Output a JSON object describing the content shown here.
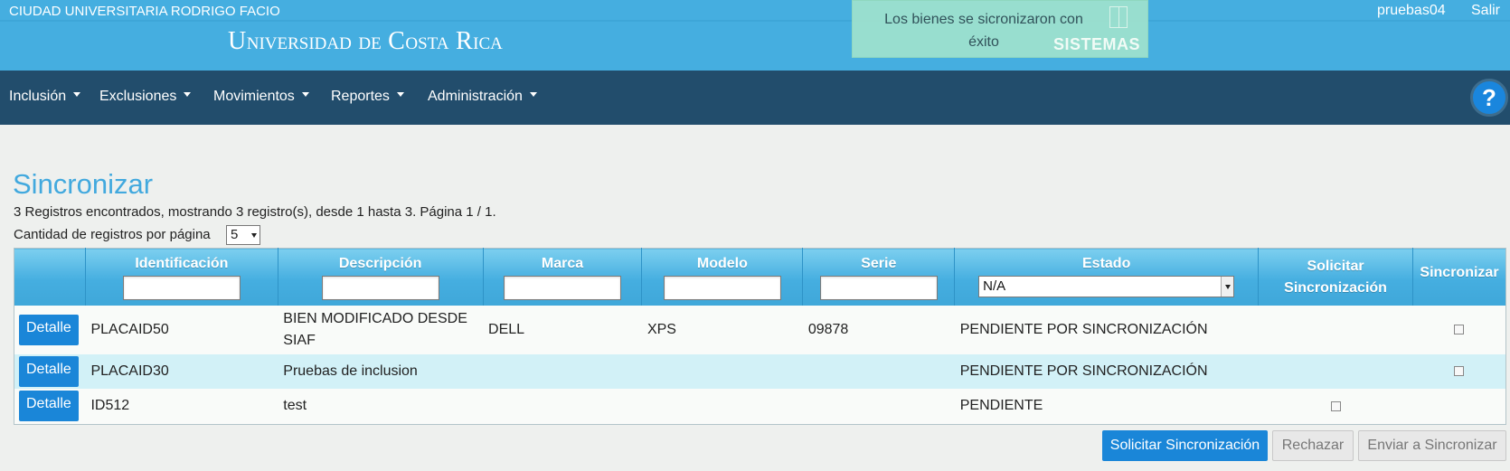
{
  "header": {
    "campus": "CIUDAD UNIVERSITARIA RODRIGO FACIO",
    "logo_big_u": "U",
    "logo_niversidad": "NIVERSIDAD",
    "logo_de": "DE",
    "logo_c": "C",
    "logo_osta": "OSTA",
    "logo_r": "R",
    "logo_ica": "ICA",
    "user": "pruebas04",
    "logout": "Salir"
  },
  "toast": {
    "message_line1": "Los bienes se sicronizaron con",
    "message_line2": "éxito",
    "system_label": "SISTEMAS"
  },
  "nav": {
    "items": [
      "Inclusión",
      "Exclusiones",
      "Movimientos",
      "Reportes",
      "Administración"
    ],
    "help_icon": "question-mark-icon",
    "help_label": "?"
  },
  "page": {
    "title": "Sincronizar",
    "records_summary": "3 Registros encontrados, mostrando 3 registro(s), desde 1 hasta 3. Página 1 / 1.",
    "per_page_label": "Cantidad de registros por página",
    "per_page_value": "5"
  },
  "table": {
    "headers": {
      "identificacion": "Identificación",
      "descripcion": "Descripción",
      "marca": "Marca",
      "modelo": "Modelo",
      "serie": "Serie",
      "estado": "Estado",
      "solicitar_l1": "Solicitar",
      "solicitar_l2": "Sincronización",
      "sincronizar": "Sincronizar"
    },
    "estado_filter_value": "N/A",
    "detail_button": "Detalle",
    "rows": [
      {
        "id": "PLACAID50",
        "descripcion_l1": "BIEN MODIFICADO DESDE",
        "descripcion_l2": "SIAF",
        "marca": "DELL",
        "modelo": "XPS",
        "serie": "09878",
        "estado": "PENDIENTE POR SINCRONIZACIÓN"
      },
      {
        "id": "PLACAID30",
        "descripcion": "Pruebas de inclusion",
        "marca": "",
        "modelo": "",
        "serie": "",
        "estado": "PENDIENTE POR SINCRONIZACIÓN"
      },
      {
        "id": "ID512",
        "descripcion": "test",
        "marca": "",
        "modelo": "",
        "serie": "",
        "estado": "PENDIENTE"
      }
    ]
  },
  "actions": {
    "request_sync": "Solicitar Sincronización",
    "reject": "Rechazar",
    "send_sync": "Enviar a Sincronizar"
  },
  "colors": {
    "header_blue": "#45aee0",
    "nav_dark": "#224d6c",
    "primary_button": "#1a86d8",
    "title_blue": "#42a9de",
    "row_highlight": "#d2f1f7"
  }
}
